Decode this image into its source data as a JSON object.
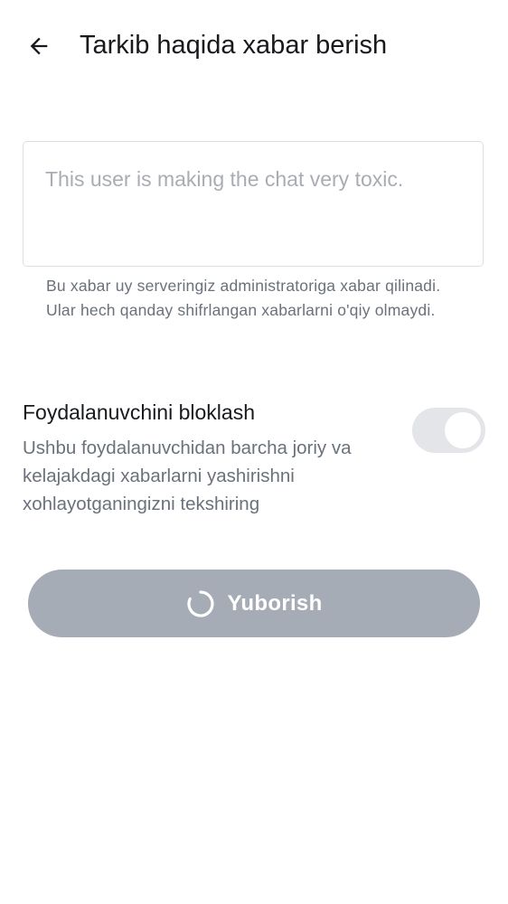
{
  "header": {
    "back_icon": "arrow-left-icon",
    "title": "Tarkib haqida xabar berish"
  },
  "report": {
    "reason_placeholder": "This user is making the chat very toxic.",
    "reason_value": "",
    "helper_text": "Bu xabar uy serveringiz administratoriga xabar qilinadi. Ular hech qanday shifrlangan xabarlarni o'qiy olmaydi."
  },
  "block_user": {
    "title": "Foydalanuvchini bloklash",
    "description": "Ushbu foydalanuvchidan barcha joriy va kelajakdagi xabarlarni yashirishni xohlayotganingizni tekshiring",
    "enabled": true
  },
  "submit": {
    "label": "Yuborish",
    "loading": true,
    "spinner_icon": "loading-spinner-icon"
  },
  "colors": {
    "button_disabled": "#a6acb6",
    "toggle_track": "#e3e5e8",
    "text_primary": "#17191c",
    "text_secondary": "#6b717b",
    "placeholder": "#a9adb3"
  }
}
